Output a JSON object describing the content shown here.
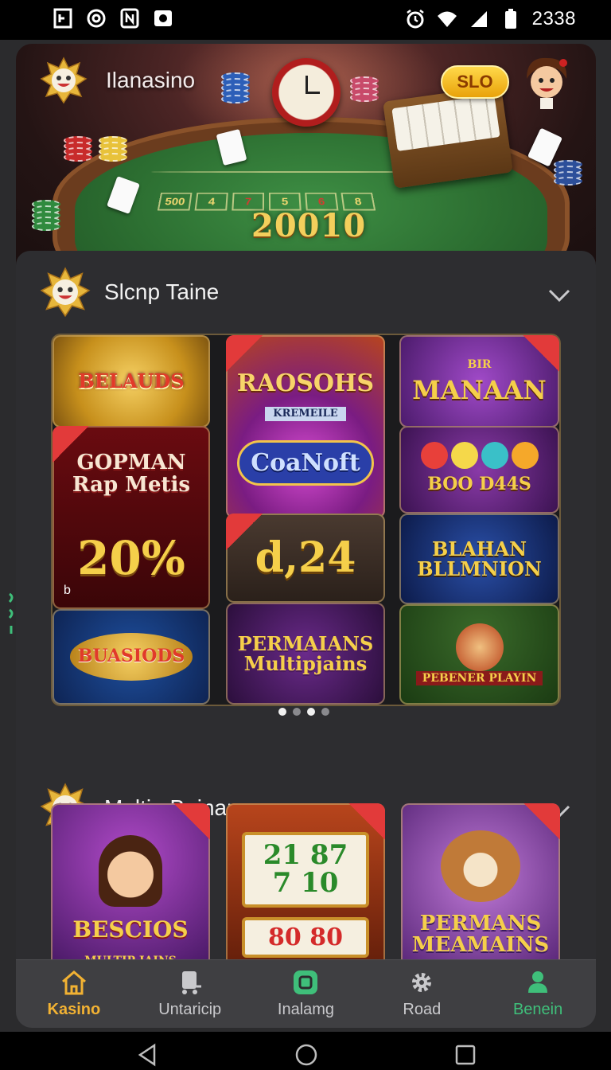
{
  "status_bar": {
    "time": "2338",
    "left_icons": [
      "sim-icon",
      "target-icon",
      "nfc-icon",
      "image-icon"
    ],
    "right_icons": [
      "alarm-icon",
      "wifi-icon",
      "signal-icon",
      "battery-icon"
    ]
  },
  "header": {
    "brand": "Ilanasino",
    "badge": "SLO",
    "hero_amount": "20010",
    "felt_numbers": [
      "500",
      "4",
      "7",
      "5",
      "6",
      "8"
    ]
  },
  "sections": [
    {
      "title": "Slcnp Taine",
      "tiles": [
        {
          "text": "BELAUDS"
        },
        {
          "text": "RAOSOHS",
          "sub": "KREMEILE"
        },
        {
          "text": "MANAAN",
          "sub": "BIR"
        },
        {
          "text": "GOPMAN Rap Metis"
        },
        {
          "text": "CoaNoft"
        },
        {
          "text": "BOO D44S"
        },
        {
          "text": "20%",
          "corner": "b"
        },
        {
          "text": "d,24"
        },
        {
          "text": "BLAHAN BLLMNION"
        },
        {
          "text": "BUASIODS"
        },
        {
          "text": "PERMAIANS Multipjains"
        },
        {
          "text": "PEBENER PLAYIN"
        }
      ],
      "page_dots": 4,
      "active_dot": 2
    },
    {
      "title": "Multip Bainan",
      "tiles": [
        {
          "text": "BESCIOS",
          "sub": "MULTIP JAINS"
        },
        {
          "text": "21 87 7 10",
          "sub": "80 80"
        },
        {
          "text": "PERMANS MEAMAINS"
        }
      ]
    }
  ],
  "bottom_nav": [
    {
      "label": "Kasino",
      "icon": "home-icon",
      "active": true
    },
    {
      "label": "Untaricip",
      "icon": "cart-icon",
      "active": false
    },
    {
      "label": "Inalamg",
      "icon": "camera-icon",
      "active": false
    },
    {
      "label": "Road",
      "icon": "gear-icon",
      "active": false
    },
    {
      "label": "Benein",
      "icon": "person-icon",
      "active": false
    }
  ],
  "colors": {
    "accent": "#f2b233",
    "green": "#3fbf7a",
    "panel": "#2d2d30",
    "nav": "#3f3f42"
  }
}
